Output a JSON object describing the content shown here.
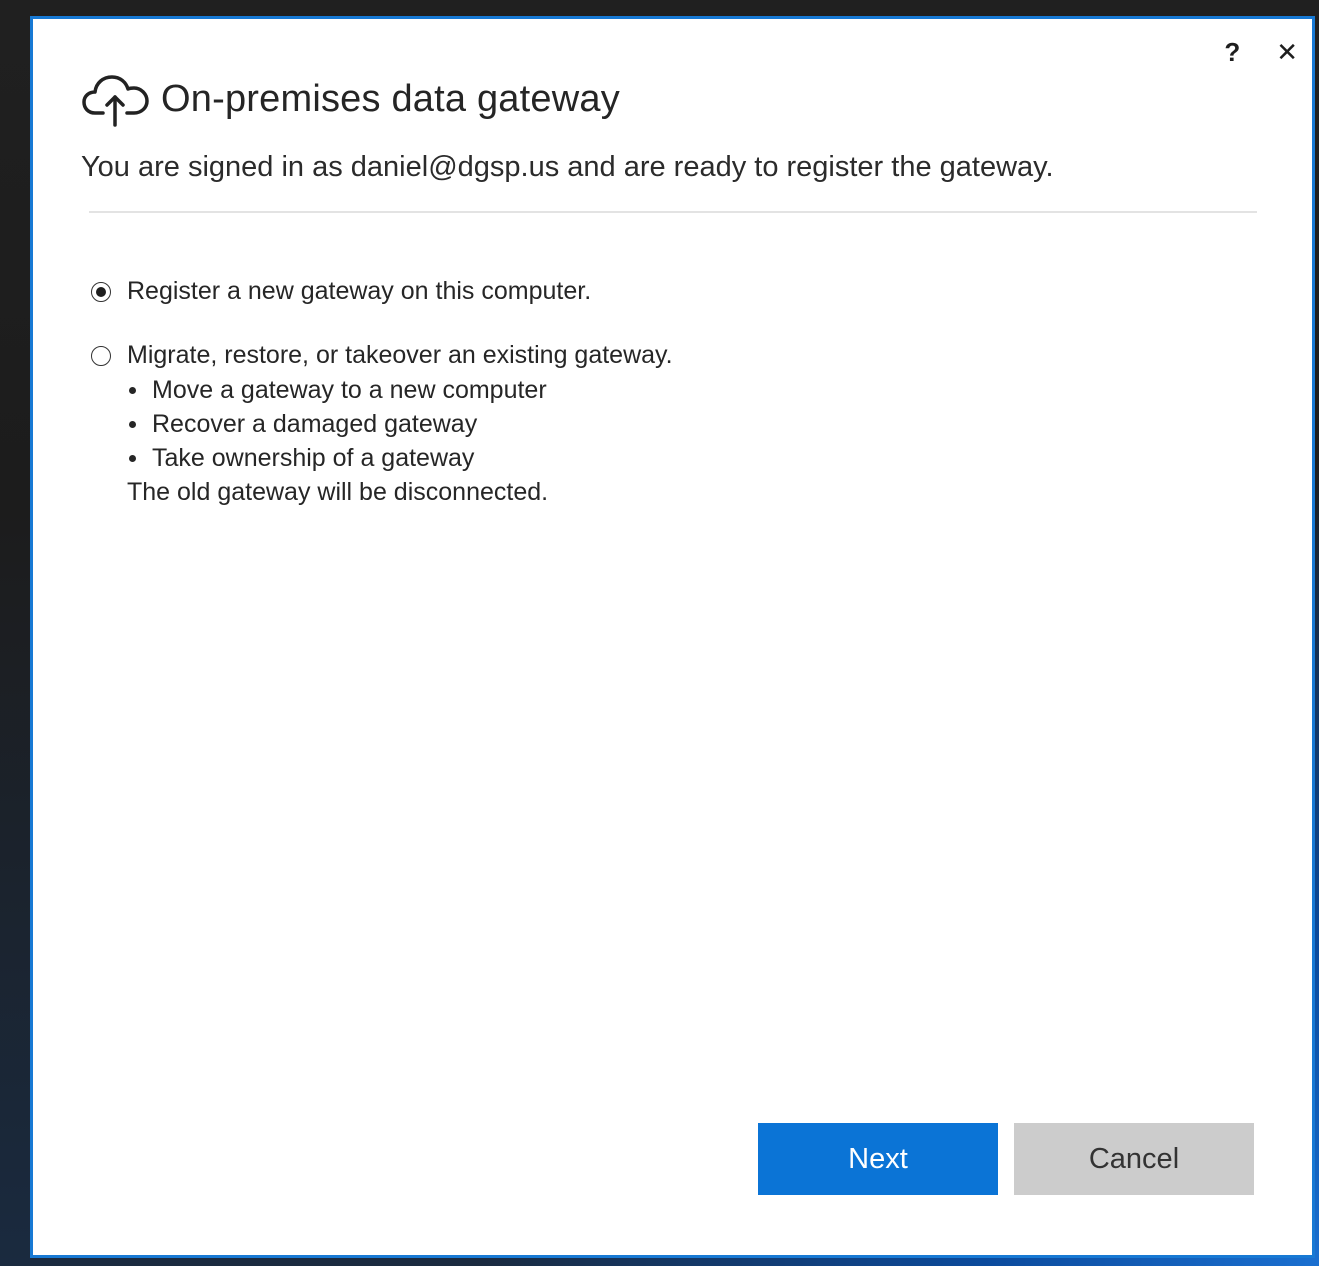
{
  "window": {
    "title": "On-premises data gateway",
    "help_label": "?",
    "close_label": "✕",
    "subtitle": "You are signed in as daniel@dgsp.us and are ready to register the gateway."
  },
  "options": [
    {
      "label": "Register a new gateway on this computer.",
      "selected": true
    },
    {
      "label": "Migrate, restore, or takeover an existing gateway.",
      "selected": false
    }
  ],
  "migrate_details": {
    "bullets": [
      "Move a gateway to a new computer",
      "Recover a damaged gateway",
      "Take ownership of a gateway"
    ],
    "note": "The old gateway will be disconnected."
  },
  "buttons": {
    "next_label": "Next",
    "cancel_label": "Cancel"
  },
  "colors": {
    "accent": "#0b74d6",
    "window_border": "#1779d4",
    "cancel_bg": "#cccccc"
  },
  "icons": {
    "header": "cloud-upload-icon"
  }
}
